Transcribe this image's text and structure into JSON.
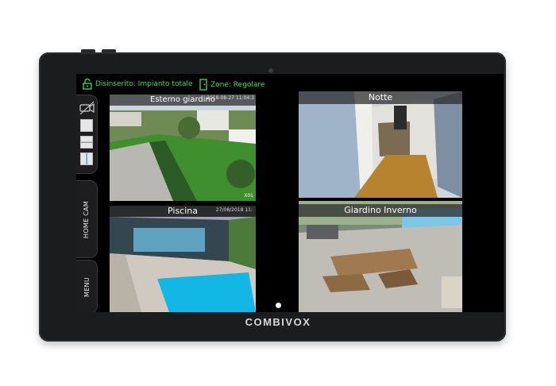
{
  "status": {
    "alarm_text": "Disinserito: Impianto totale",
    "zone_text": "Zone: Regolare"
  },
  "sidebar": {
    "home_cam_label": "HOME CAM",
    "menu_label": "MENU"
  },
  "cameras": [
    {
      "label": "Esterno giardino",
      "timestamp": "2018-08-27 11:04:3",
      "corner_code": "X01"
    },
    {
      "label": "Notte"
    },
    {
      "label": "Piscina",
      "timestamp": "27/08/2018 11:"
    },
    {
      "label": "Giardino Inverno"
    }
  ],
  "brand": "COMBIVOX",
  "colors": {
    "status_green": "#33e35a",
    "bezel": "#1b1c1e"
  },
  "icons": {
    "lock": "lock-open-icon",
    "door": "door-icon",
    "camera_settings": "camera-settings-icon"
  }
}
